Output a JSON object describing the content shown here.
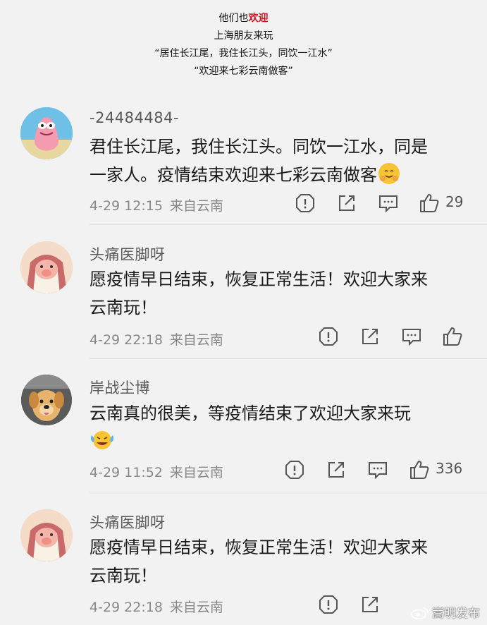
{
  "header": {
    "line1_prefix": "他们也",
    "line1_accent": "欢迎",
    "line2": "上海朋友来玩",
    "line3": "“居住长江尾，我住长江头，同饮一江水”",
    "line4": "“欢迎来七彩云南做客”"
  },
  "comments": [
    {
      "username": "-24484484-",
      "text_line1": "君住长江尾，我住长江头。同饮一江水，同是",
      "text_line2": "一家人。疫情结束欢迎来七彩云南做客",
      "emoji": "hug-face-emoji",
      "date": "4-29 12:15",
      "source": "来自云南",
      "likes": "29"
    },
    {
      "username": "头痛医脚呀",
      "text_line1": "愿疫情早日结束，恢复正常生活！欢迎大家来",
      "text_line2": "云南玩！",
      "date": "4-29 22:18",
      "source": "来自云南",
      "likes": ""
    },
    {
      "username": "岸战尘博",
      "text_line1": "云南真的很美，等疫情结束了欢迎大家来玩",
      "emoji": "tears-of-joy-emoji",
      "date": "4-29 11:52",
      "source": "来自云南",
      "likes": "336"
    },
    {
      "username": "头痛医脚呀",
      "text_line1": "愿疫情早日结束，恢复正常生活！欢迎大家来",
      "text_line2": "云南玩！",
      "date": "4-29 22:18",
      "source": "来自云南",
      "likes": ""
    }
  ],
  "watermark": {
    "text": "嵩明发布",
    "icon": "weibo-icon"
  },
  "colors": {
    "accent": "#d0121b",
    "background": "#f2f2f2",
    "meta": "#888888"
  }
}
